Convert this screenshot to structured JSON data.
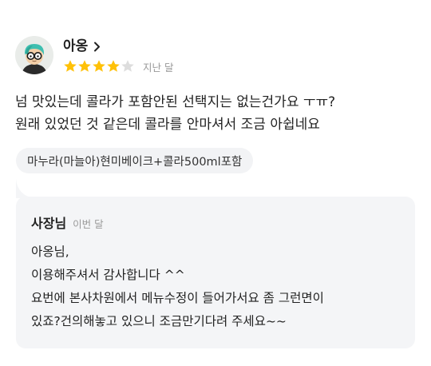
{
  "review": {
    "author": "아옹",
    "rating": 4,
    "max_rating": 5,
    "date": "지난 달",
    "text_lines": [
      "넘 맛있는데 콜라가 포함안된 선택지는 없는건가요 ㅜㅠ?",
      "원래 있었던 것 같은데 콜라를 안마셔서 조금 아쉽네요"
    ],
    "menu_tag": "마누라(마늘아)현미베이크+콜라500ml포함"
  },
  "reply": {
    "owner": "사장님",
    "date": "이번 달",
    "text_lines": [
      "아옹님,",
      "이용해주셔서 감사합니다 ^^",
      "요번에 본사차원에서 메뉴수정이 들어가서요 좀 그런면이",
      "있죠?건의해놓고 있으니 조금만기다려 주세요~~"
    ]
  },
  "colors": {
    "star_filled": "#FFC107",
    "star_empty": "#DDDDDD",
    "reply_bg": "#F4F5F7",
    "tag_bg": "#F2F3F5"
  }
}
